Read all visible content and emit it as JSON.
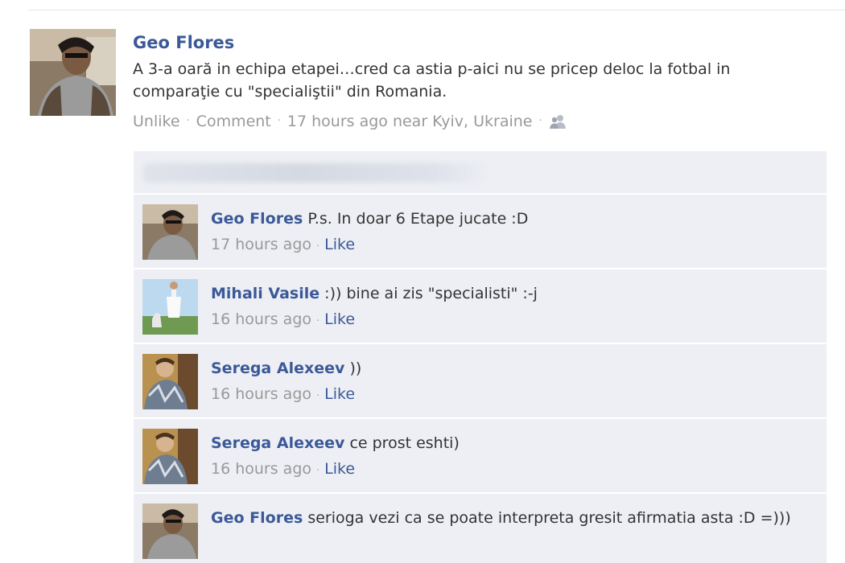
{
  "post": {
    "author": "Geo Flores",
    "text": "A 3-a oară in echipa etapei…cred ca astia p-aici nu se pricep deloc la fotbal in comparaţie cu \"specialiştii\" din Romania.",
    "actions": {
      "unlike": "Unlike",
      "comment": "Comment",
      "time": "17 hours ago near Kyiv, Ukraine",
      "separator": "·"
    }
  },
  "comments": [
    {
      "author": "Geo Flores",
      "text": "P.s. In doar 6 Etape jucate :D",
      "time": "17 hours ago",
      "like": "Like"
    },
    {
      "author": "Mihali Vasile",
      "text": ":)) bine ai zis \"specialisti\" :-j",
      "time": "16 hours ago",
      "like": "Like"
    },
    {
      "author": "Serega Alexeev",
      "text": "))",
      "time": "16 hours ago",
      "like": "Like"
    },
    {
      "author": "Serega Alexeev",
      "text": "ce prost eshti)",
      "time": "16 hours ago",
      "like": "Like"
    },
    {
      "author": "Geo Flores",
      "text": "serioga vezi ca se poate interpreta gresit afirmatia asta :D =)))",
      "time": "",
      "like": ""
    }
  ],
  "icons": {
    "privacy": "friends-icon"
  },
  "colors": {
    "link": "#3b5998",
    "meta": "#999999",
    "comment_bg": "#edeff4"
  }
}
